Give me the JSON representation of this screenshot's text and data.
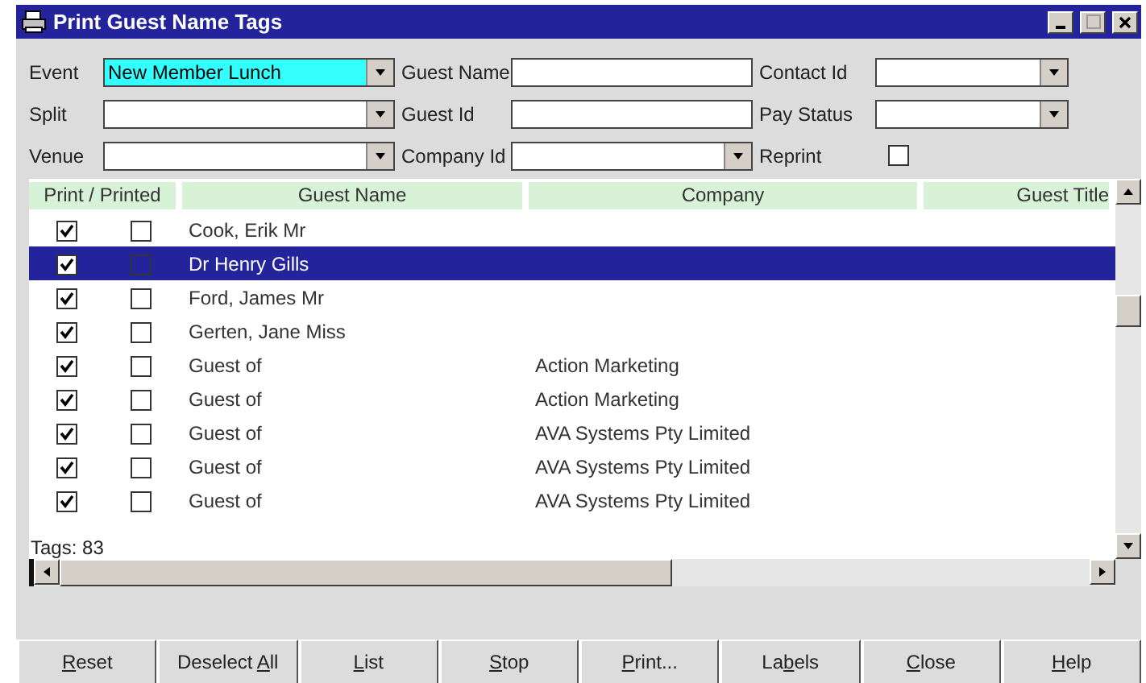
{
  "window": {
    "title": "Print Guest Name Tags"
  },
  "filters": [
    {
      "kind": "combo",
      "label": "Event",
      "value": "New Member Lunch",
      "highlighted": true
    },
    {
      "kind": "text",
      "label": "Guest Name"
    },
    {
      "kind": "combo",
      "label": "Contact Id"
    },
    {
      "kind": "combo",
      "label": "Split",
      "highlighted": false
    },
    {
      "kind": "text",
      "label": "Guest Id"
    },
    {
      "kind": "combo",
      "label": "Pay Status"
    },
    {
      "kind": "combo",
      "label": "Venue",
      "highlighted": false
    },
    {
      "kind": "combo",
      "label": "Company Id"
    },
    {
      "kind": "check",
      "label": "Reprint",
      "checked": false
    }
  ],
  "table": {
    "columns": [
      "Print / Printed",
      "Guest Name",
      "Company",
      "Guest Title"
    ],
    "rows": [
      {
        "print": true,
        "printed": false,
        "guest_name": "Cook, Erik Mr",
        "selected": false
      },
      {
        "print": true,
        "printed": false,
        "guest_name": "Dr Henry Gills",
        "selected": true
      },
      {
        "print": true,
        "printed": false,
        "guest_name": "Ford, James Mr",
        "selected": false
      },
      {
        "print": true,
        "printed": false,
        "guest_name": "Gerten, Jane Miss",
        "selected": false
      },
      {
        "print": true,
        "printed": false,
        "guest_name": "Guest of",
        "company": "Action Marketing",
        "selected": false
      },
      {
        "print": true,
        "printed": false,
        "guest_name": "Guest of",
        "company": "Action Marketing",
        "selected": false
      },
      {
        "print": true,
        "printed": false,
        "guest_name": "Guest of",
        "company": "AVA Systems Pty Limited",
        "selected": false
      },
      {
        "print": true,
        "printed": false,
        "guest_name": "Guest of",
        "company": "AVA Systems Pty Limited",
        "selected": false
      },
      {
        "print": true,
        "printed": false,
        "guest_name": "Guest of",
        "company": "AVA Systems Pty Limited",
        "selected": false
      }
    ]
  },
  "tags_count": "Tags: 83",
  "buttons": [
    {
      "label_parts": [
        {
          "text": "R",
          "underlined": true
        },
        {
          "text": "eset",
          "underlined": false
        }
      ]
    },
    {
      "label_parts": [
        {
          "text": "Deselect ",
          "underlined": false
        },
        {
          "text": "A",
          "underlined": true
        },
        {
          "text": "ll",
          "underlined": false
        }
      ]
    },
    {
      "label_parts": [
        {
          "text": "L",
          "underlined": true
        },
        {
          "text": "ist",
          "underlined": false
        }
      ]
    },
    {
      "label_parts": [
        {
          "text": "S",
          "underlined": true
        },
        {
          "text": "top",
          "underlined": false
        }
      ]
    },
    {
      "label_parts": [
        {
          "text": "P",
          "underlined": true
        },
        {
          "text": "rint...",
          "underlined": false
        }
      ]
    },
    {
      "label_parts": [
        {
          "text": "La",
          "underlined": false
        },
        {
          "text": "b",
          "underlined": true
        },
        {
          "text": "els",
          "underlined": false
        }
      ]
    },
    {
      "label_parts": [
        {
          "text": "C",
          "underlined": true
        },
        {
          "text": "lose",
          "underlined": false
        }
      ]
    },
    {
      "label_parts": [
        {
          "text": "H",
          "underlined": true
        },
        {
          "text": "elp",
          "underlined": false
        }
      ]
    }
  ]
}
